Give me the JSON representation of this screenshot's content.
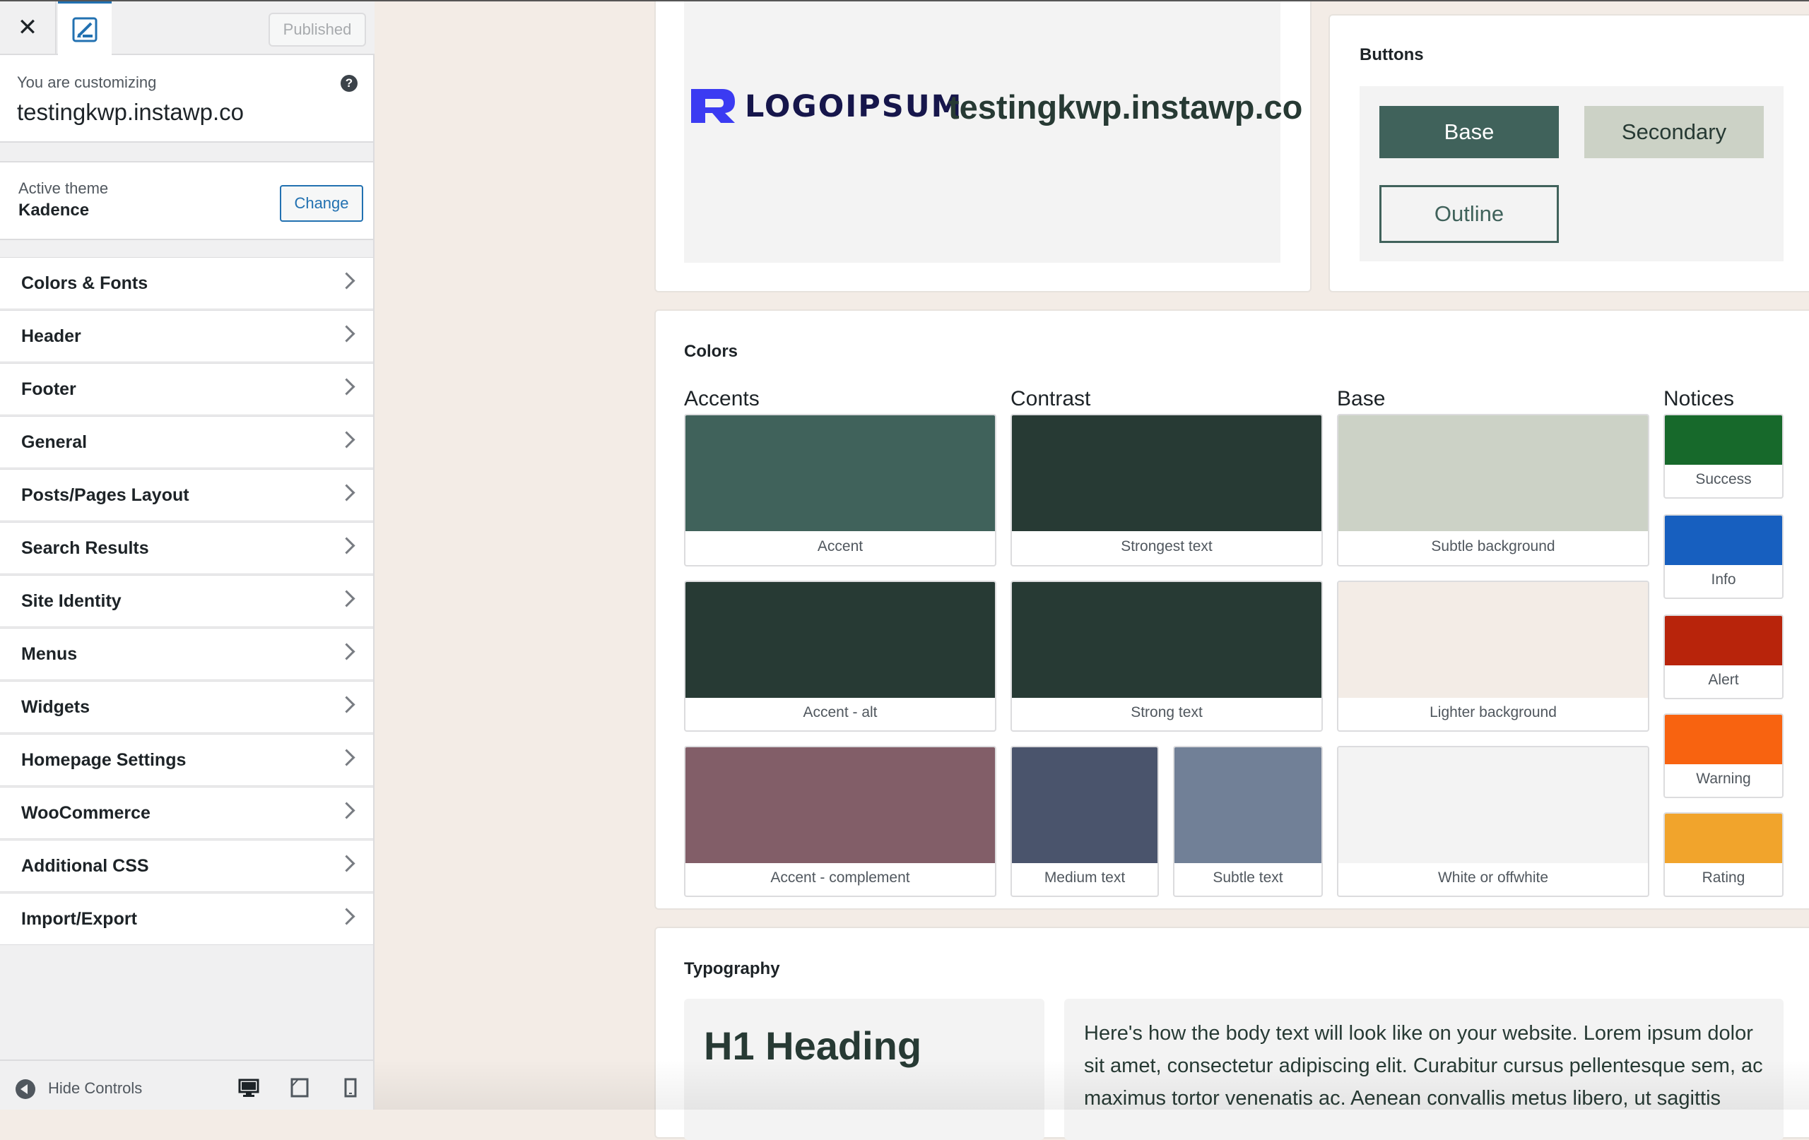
{
  "sidebar": {
    "published_label": "Published",
    "customizing_label": "You are customizing",
    "site_name": "testingkwp.instawp.co",
    "help_symbol": "?",
    "active_theme_label": "Active theme",
    "theme_name": "Kadence",
    "change_label": "Change",
    "items": [
      {
        "label": "Colors & Fonts"
      },
      {
        "label": "Header"
      },
      {
        "label": "Footer"
      },
      {
        "label": "General"
      },
      {
        "label": "Posts/Pages Layout"
      },
      {
        "label": "Search Results"
      },
      {
        "label": "Site Identity"
      },
      {
        "label": "Menus"
      },
      {
        "label": "Widgets"
      },
      {
        "label": "Homepage Settings"
      },
      {
        "label": "WooCommerce"
      },
      {
        "label": "Additional CSS"
      },
      {
        "label": "Import/Export"
      }
    ],
    "hide_controls_label": "Hide Controls"
  },
  "preview": {
    "logo_text": "LOGOIPSUM",
    "site_title": "testingkwp.instawp.co",
    "buttons": {
      "title": "Buttons",
      "base": "Base",
      "secondary": "Secondary",
      "outline": "Outline"
    },
    "colors": {
      "title": "Colors",
      "accents_head": "Accents",
      "contrast_head": "Contrast",
      "base_head": "Base",
      "notices_head": "Notices",
      "accent": {
        "label": "Accent",
        "color": "#40625b"
      },
      "accent_alt": {
        "label": "Accent - alt",
        "color": "#273a34"
      },
      "accent_complement": {
        "label": "Accent - complement",
        "color": "#825e68"
      },
      "strongest_text": {
        "label": "Strongest text",
        "color": "#273a34"
      },
      "strong_text": {
        "label": "Strong text",
        "color": "#273a34"
      },
      "medium_text": {
        "label": "Medium text",
        "color": "#4a546c"
      },
      "subtle_text": {
        "label": "Subtle text",
        "color": "#718097"
      },
      "subtle_background": {
        "label": "Subtle background",
        "color": "#ccd2c6"
      },
      "lighter_background": {
        "label": "Lighter background",
        "color": "#f3ece6"
      },
      "white_offwhite": {
        "label": "White or offwhite",
        "color": "#f3f3f3"
      },
      "success": {
        "label": "Success",
        "color": "#17692b"
      },
      "info": {
        "label": "Info",
        "color": "#175fbf"
      },
      "alert": {
        "label": "Alert",
        "color": "#b8240b"
      },
      "warning": {
        "label": "Warning",
        "color": "#f86310"
      },
      "rating": {
        "label": "Rating",
        "color": "#f1a42c"
      }
    },
    "typography": {
      "title": "Typography",
      "h1": "H1 Heading",
      "body": "Here's how the body text will look like on your website. Lorem ipsum dolor sit amet, consectetur adipiscing elit. Curabitur cursus pellentesque sem, ac maximus tortor venenatis ac. Aenean convallis metus libero, ut sagittis"
    }
  }
}
